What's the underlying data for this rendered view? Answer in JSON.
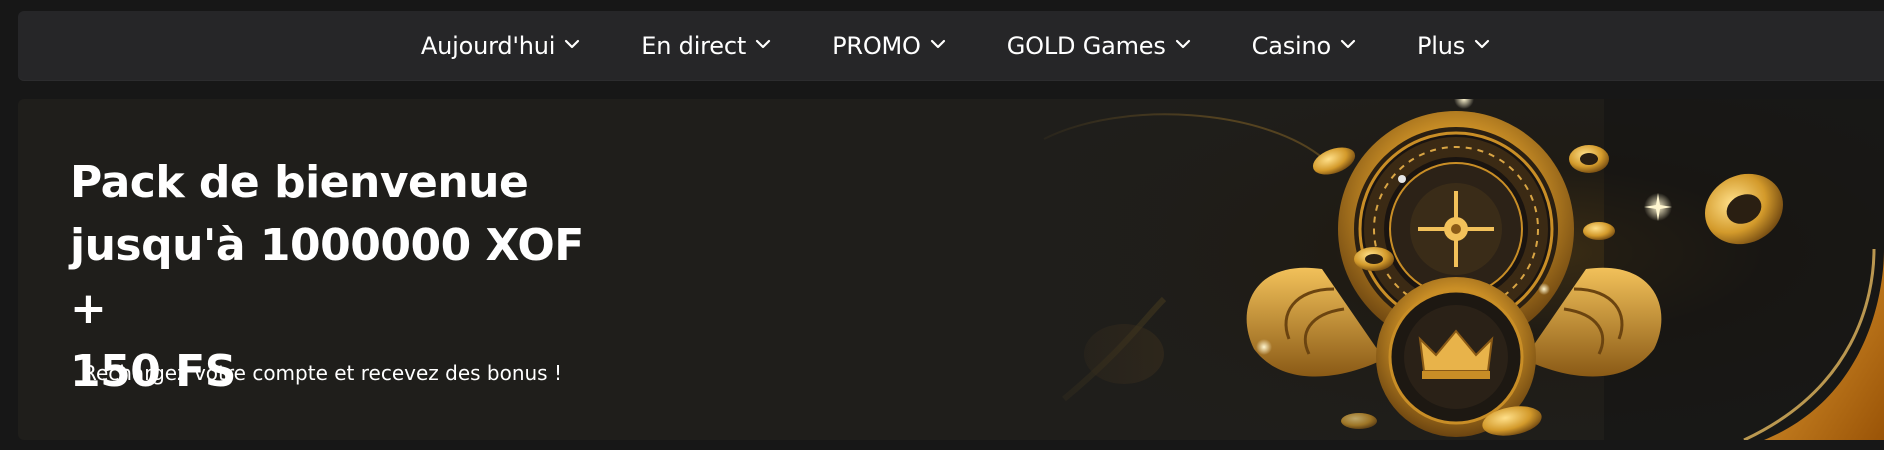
{
  "nav": {
    "items": [
      {
        "label": "Aujourd'hui",
        "icon": "chevron-down-icon"
      },
      {
        "label": "En direct",
        "icon": "chevron-down-icon"
      },
      {
        "label": "PROMO",
        "icon": "chevron-down-icon"
      },
      {
        "label": "GOLD Games",
        "icon": "chevron-down-icon"
      },
      {
        "label": "Casino",
        "icon": "chevron-down-icon"
      },
      {
        "label": "Plus",
        "icon": "chevron-down-icon"
      }
    ]
  },
  "banner": {
    "title_line1": "Pack de bienvenue",
    "title_line2": "jusqu'à 1000000 XOF +",
    "title_line3": "150 FS",
    "subtitle": "Rechargez votre compte et recevez des bonus !",
    "art": "roulette-wheel-winged-gold-crown-illustration"
  },
  "colors": {
    "page_bg": "#171717",
    "nav_bg": "#262628",
    "banner_bg": "#1f1e1b",
    "gold": "#d4a033",
    "text": "#ffffff"
  }
}
